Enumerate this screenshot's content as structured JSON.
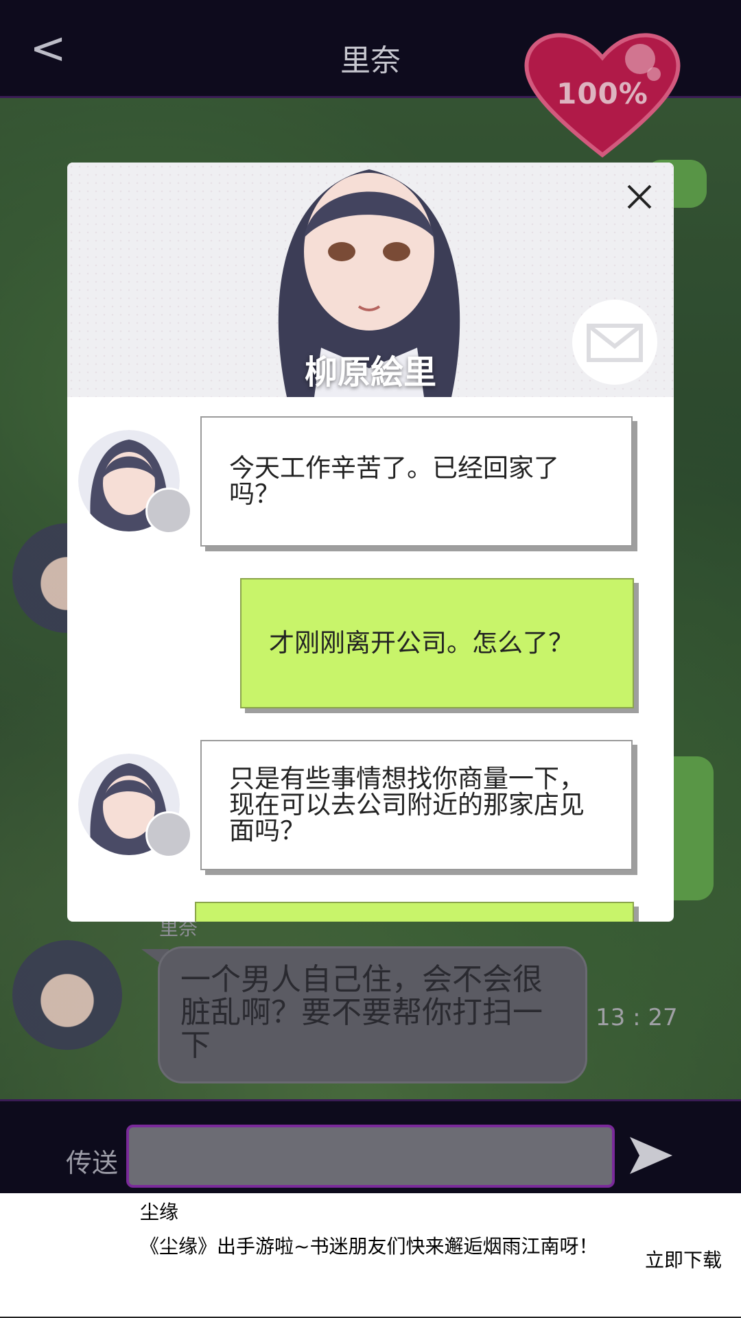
{
  "header": {
    "back_icon": "back-chevron-icon",
    "title": "里奈",
    "affection": "100%"
  },
  "background_chat": {
    "sender_name": "里奈",
    "message": "一个男人自己住，会不会很脏乱啊？要不要帮你打扫一下",
    "time": "13 : 27"
  },
  "modal": {
    "character_name": "柳原絵里",
    "close_icon": "close-icon",
    "mail_icon": "mail-icon",
    "messages": [
      {
        "from": "character",
        "text": "今天工作辛苦了。已经回家了吗？"
      },
      {
        "from": "player",
        "text": "才刚刚离开公司。怎么了？"
      },
      {
        "from": "character",
        "text": "只是有些事情想找你商量一下，现在可以去公司附近的那家店见面吗？"
      },
      {
        "from": "player",
        "text": ""
      }
    ]
  },
  "input_bar": {
    "send_label": "传送",
    "input_value": "",
    "send_icon": "send-arrow-icon"
  },
  "ad": {
    "title": "尘缘",
    "text": "《尘缘》出手游啦~书迷朋友们快来邂逅烟雨江南呀！",
    "button": "立即下载"
  },
  "colors": {
    "player_bubble": "#c8f46a",
    "input_border": "#7a2a9a",
    "heart": "#b01a48"
  }
}
